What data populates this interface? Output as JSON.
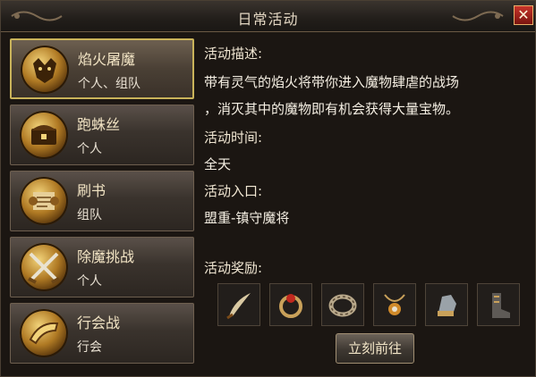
{
  "window": {
    "title": "日常活动",
    "close_glyph": "✕"
  },
  "activities": [
    {
      "name": "焰火屠魔",
      "mode": "个人、组队",
      "icon": "demon-head-icon",
      "selected": true
    },
    {
      "name": "跑蛛丝",
      "mode": "个人",
      "icon": "treasure-chest-icon",
      "selected": false
    },
    {
      "name": "刷书",
      "mode": "组队",
      "icon": "scroll-icon",
      "selected": false
    },
    {
      "name": "除魔挑战",
      "mode": "个人",
      "icon": "crossed-swords-icon",
      "selected": false
    },
    {
      "name": "行会战",
      "mode": "行会",
      "icon": "war-horn-icon",
      "selected": false
    }
  ],
  "detail": {
    "desc_label": "活动描述:",
    "desc_line1": "带有灵气的焰火将带你进入魔物肆虐的战场",
    "desc_line2": "，消灭其中的魔物即有机会获得大量宝物。",
    "time_label": "活动时间:",
    "time_value": "全天",
    "entry_label": "活动入口:",
    "entry_value": "盟重-镇守魔将",
    "reward_label": "活动奖励:",
    "rewards": [
      "curved-blade-icon",
      "ruby-ring-icon",
      "bracelet-icon",
      "amulet-icon",
      "gauntlet-icon",
      "boots-icon"
    ]
  },
  "go_button": "立刻前往",
  "colors": {
    "accent_gold": "#c9b35a",
    "close_red": "#c7342a",
    "panel_bg": "#1b1612"
  }
}
